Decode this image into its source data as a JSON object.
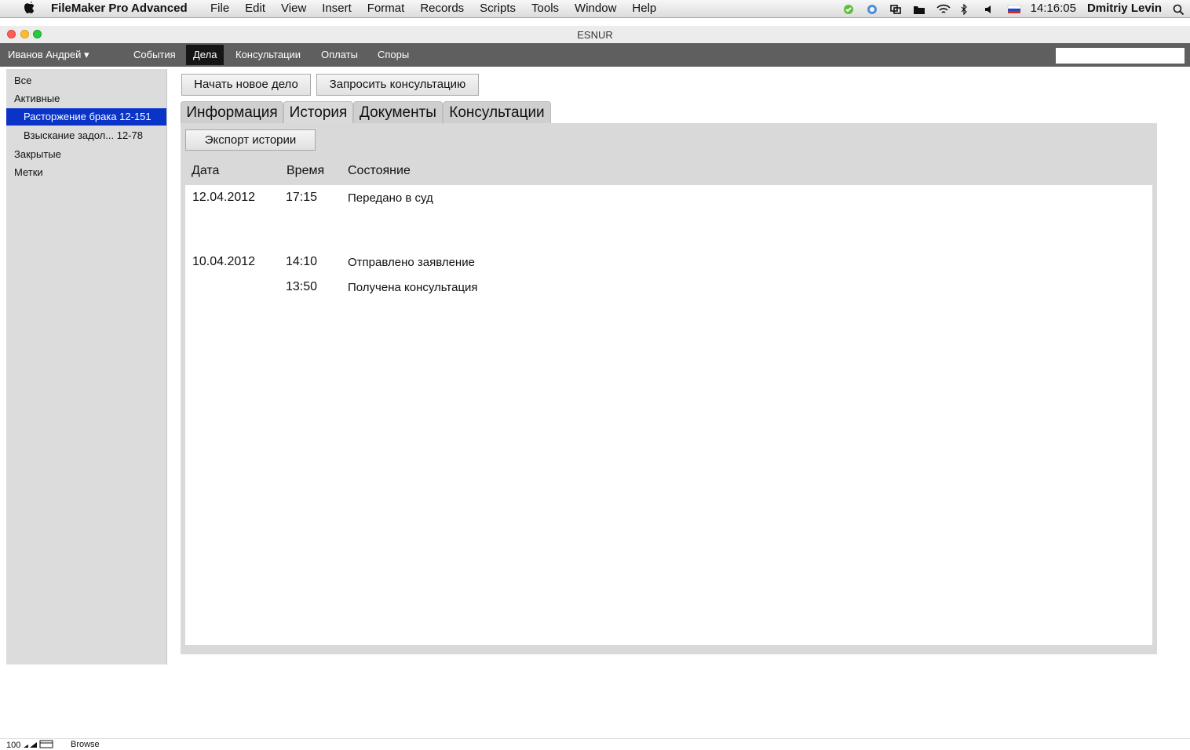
{
  "menubar": {
    "app_name": "FileMaker Pro Advanced",
    "menus": [
      "File",
      "Edit",
      "View",
      "Insert",
      "Format",
      "Records",
      "Scripts",
      "Tools",
      "Window",
      "Help"
    ],
    "clock": "14:16:05",
    "user": "Dmitriy Levin"
  },
  "window": {
    "title": "ESNUR"
  },
  "navbar": {
    "user_menu": "Иванов Андрей ▾",
    "items": [
      "События",
      "Дела",
      "Консультации",
      "Оплаты",
      "Споры"
    ],
    "active_item": "Дела"
  },
  "sidebar": {
    "all": "Все",
    "active": "Активные",
    "cases": [
      {
        "label": "Расторжение брака 12-151",
        "selected": true
      },
      {
        "label": "Взыскание задол... 12-78",
        "selected": false
      }
    ],
    "closed": "Закрытые",
    "tags": "Метки"
  },
  "actions": {
    "new_case": "Начать новое дело",
    "request_consultation": "Запросить консультацию"
  },
  "tabs": [
    "Информация",
    "История",
    "Документы",
    "Консультации"
  ],
  "active_tab": "История",
  "history": {
    "export_label": "Экспорт истории",
    "columns": {
      "date": "Дата",
      "time": "Время",
      "state": "Состояние"
    },
    "rows": [
      {
        "date": "12.04.2012",
        "time": "17:15",
        "state": "Передано в суд"
      },
      {
        "date": "10.04.2012",
        "time": "14:10",
        "state": "Отправлено заявление"
      },
      {
        "date": "",
        "time": "13:50",
        "state": "Получена консультация"
      }
    ]
  },
  "statusbar": {
    "zoom": "100",
    "mode": "Browse"
  },
  "colors": {
    "selection": "#0a33c8",
    "navbar": "#5f5f5f",
    "panel": "#d9d9d9"
  }
}
